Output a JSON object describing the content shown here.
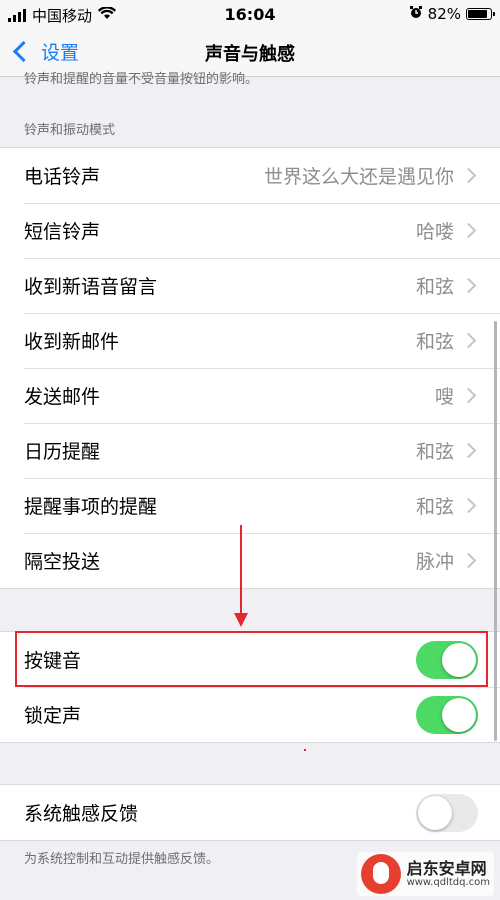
{
  "status_bar": {
    "carrier": "中国移动",
    "time": "16:04",
    "battery": "82%",
    "battery_level": 0.82
  },
  "nav": {
    "back_label": "设置",
    "title": "声音与触感"
  },
  "note_top": "铃声和提醒的音量不受音量按钮的影响。",
  "ringtone_section": {
    "header": "铃声和振动模式",
    "items": [
      {
        "label": "电话铃声",
        "value": "世界这么大还是遇见你"
      },
      {
        "label": "短信铃声",
        "value": "哈喽"
      },
      {
        "label": "收到新语音留言",
        "value": "和弦"
      },
      {
        "label": "收到新邮件",
        "value": "和弦"
      },
      {
        "label": "发送邮件",
        "value": "嗖"
      },
      {
        "label": "日历提醒",
        "value": "和弦"
      },
      {
        "label": "提醒事项的提醒",
        "value": "和弦"
      },
      {
        "label": "隔空投送",
        "value": "脉冲"
      }
    ]
  },
  "sound_section": {
    "items": [
      {
        "label": "按键音",
        "on": true
      },
      {
        "label": "锁定声",
        "on": true
      }
    ]
  },
  "haptic_section": {
    "label": "系统触感反馈",
    "on": false,
    "footer": "为系统控制和互动提供触感反馈。"
  },
  "watermark": {
    "name": "启东安卓网",
    "url": "www.qdltdq.com"
  },
  "colors": {
    "accent": "#1b7cf5",
    "toggle_on": "#4cd964",
    "annotation": "#e0282e"
  }
}
